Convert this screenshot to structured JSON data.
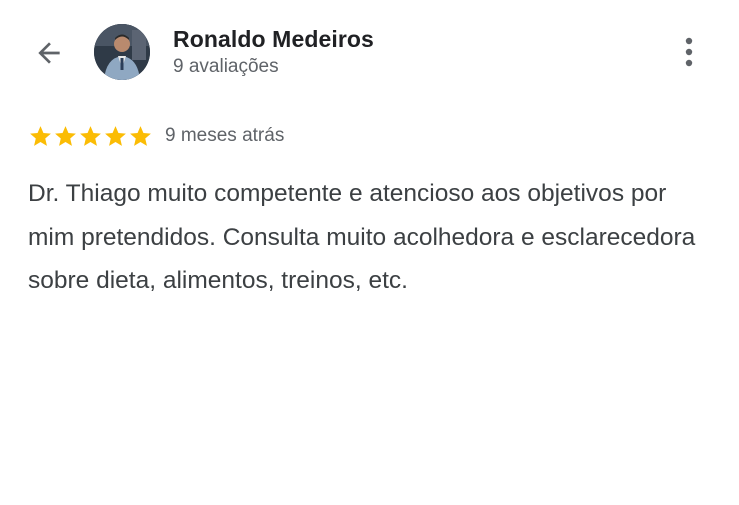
{
  "header": {
    "back_icon": "arrow-back-icon",
    "reviewer_name": "Ronaldo Medeiros",
    "review_count": "9 avaliações",
    "more_icon": "more-vert-icon"
  },
  "review": {
    "rating": 5,
    "rating_max": 5,
    "star_color": "#FBBC04",
    "time_ago": "9 meses atrás",
    "text": "Dr. Thiago muito competente e atencioso aos objetivos por mim pretendidos. Consulta muito acolhedora e esclarecedora sobre dieta, alimentos, treinos, etc."
  }
}
